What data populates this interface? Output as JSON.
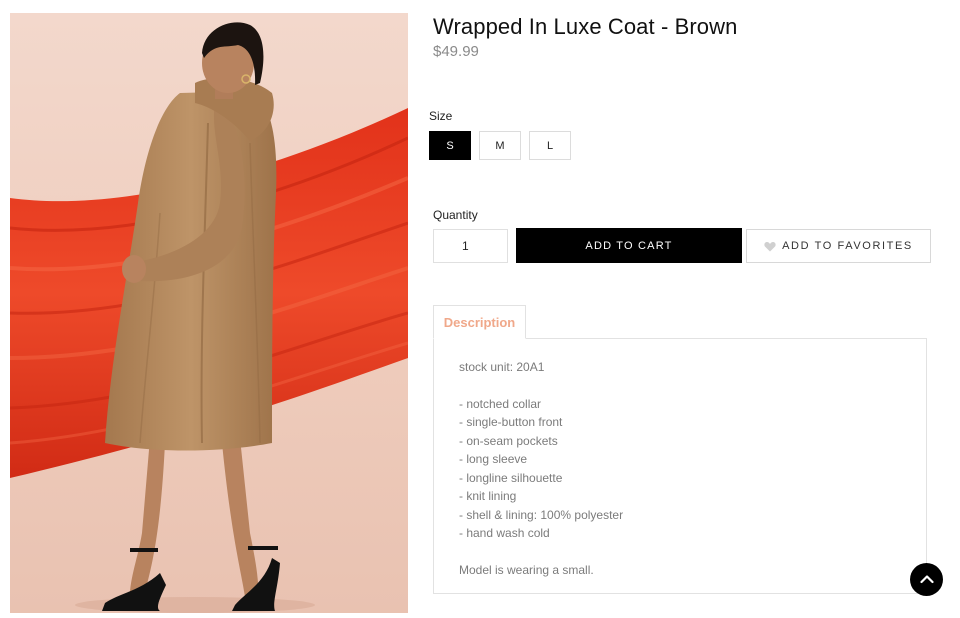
{
  "product": {
    "title": "Wrapped In Luxe Coat - Brown",
    "price": "$49.99"
  },
  "size": {
    "label": "Size",
    "options": [
      "S",
      "M",
      "L"
    ],
    "selected": "S"
  },
  "quantity": {
    "label": "Quantity",
    "value": "1"
  },
  "actions": {
    "add_to_cart": "ADD TO CART",
    "add_to_favorites": "ADD TO FAVORITES"
  },
  "description": {
    "tab_label": "Description",
    "stock_unit": "stock unit: 20A1",
    "features": [
      "- notched collar",
      "- single-button front",
      "- on-seam pockets",
      "- long sleeve",
      "- longline silhouette",
      "- knit lining",
      "- shell & lining: 100% polyester",
      "- hand wash cold"
    ],
    "model_note": "Model is wearing a small."
  },
  "icons": {
    "favorite": "heart-icon",
    "back_to_top": "chevron-up-icon"
  },
  "colors": {
    "accent_tab": "#f0a88a",
    "primary_button": "#000000",
    "price": "#8a8a8a"
  }
}
